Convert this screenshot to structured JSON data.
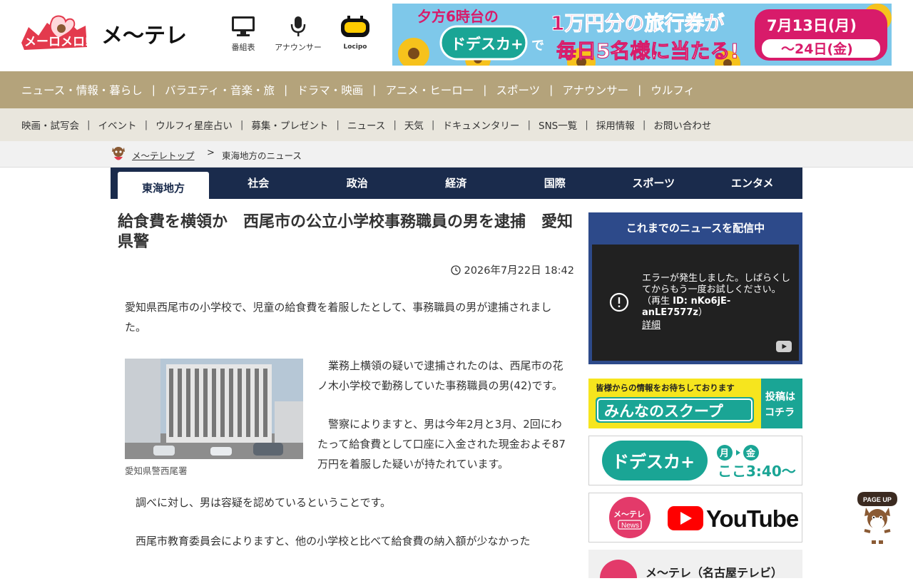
{
  "header": {
    "brand_jp": "メ～テレ",
    "brand_mascot_text": "メーロメロ!",
    "icons": [
      {
        "name": "tv-icon",
        "label": "番組表"
      },
      {
        "name": "microphone-icon",
        "label": "アナウンサー"
      },
      {
        "name": "locipo-icon",
        "label": "Locipo"
      }
    ],
    "banner": {
      "line1_left": "夕方6時台の",
      "brand": "ドデスカ+",
      "de": "で",
      "headline": "1万円分の旅行券が",
      "headline2": "毎日5名様に当たる!",
      "date1": "7月13日(月)",
      "date2": "～24日(金)"
    }
  },
  "main_nav": [
    "ニュース・情報・暮らし",
    "バラエティ・音楽・旅",
    "ドラマ・映画",
    "アニメ・ヒーロー",
    "スポーツ",
    "アナウンサー",
    "ウルフィ"
  ],
  "sub_nav": [
    "映画・試写会",
    "イベント",
    "ウルフィ星座占い",
    "募集・プレゼント",
    "ニュース",
    "天気",
    "ドキュメンタリー",
    "SNS一覧",
    "採用情報",
    "お問い合わせ"
  ],
  "separator": "|",
  "breadcrumb": {
    "home": "メ～テレトップ",
    "arrow": ">",
    "current": "東海地方のニュース"
  },
  "tabs": [
    "東海地方",
    "社会",
    "政治",
    "経済",
    "国際",
    "スポーツ",
    "エンタメ"
  ],
  "article": {
    "title": "給食費を横領か　西尾市の公立小学校事務職員の男を逮捕　愛知県警",
    "date": "2026年7月22日 18:42",
    "lead": "愛知県西尾市の小学校で、児童の給食費を着服したとして、事務職員の男が逮捕されました。",
    "photo_caption": "愛知県警西尾署",
    "p1": "業務上横領の疑いで逮捕されたのは、西尾市の花ノ木小学校で勤務していた事務職員の男(42)です。",
    "p2": "警察によりますと、男は今年2月と3月、2回にわたって給食費として口座に入金された現金およそ87万円を着服した疑いが持たれています。",
    "p3": "調べに対し、男は容疑を認めているということです。",
    "p4": "西尾市教育委員会によりますと、他の小学校と比べて給食費の納入額が少なかった"
  },
  "sidebar": {
    "live_title": "これまでのニュースを配信中",
    "player_error": "エラーが発生しました。しばらくしてからもう一度お試しください。（再生",
    "player_id": "ID: nKo6jE-anLE7577z",
    "player_id_close": "）",
    "player_more": "詳細",
    "scoop_top": "皆様からの情報をお待ちしております",
    "scoop_main": "みんなのスクープ",
    "scoop_cta1": "投稿は",
    "scoop_cta2": "コチラ",
    "dodesuka_brand": "ドデスカ+",
    "dodesuka_days1": "月",
    "dodesuka_days2": "金",
    "dodesuka_time": "ここ3:40～",
    "yt_news": "メ～テレ",
    "yt_news_sub": "News",
    "yt_brand": "YouTube",
    "bottom_label": "メ～テレ（名古屋テレビ）"
  },
  "pageup": "PAGE UP",
  "colors": {
    "gold": "#b4a37b",
    "navy": "#1a2b4c",
    "live_blue": "#2d4a8a",
    "subnav_bg": "#e9e6dd"
  }
}
